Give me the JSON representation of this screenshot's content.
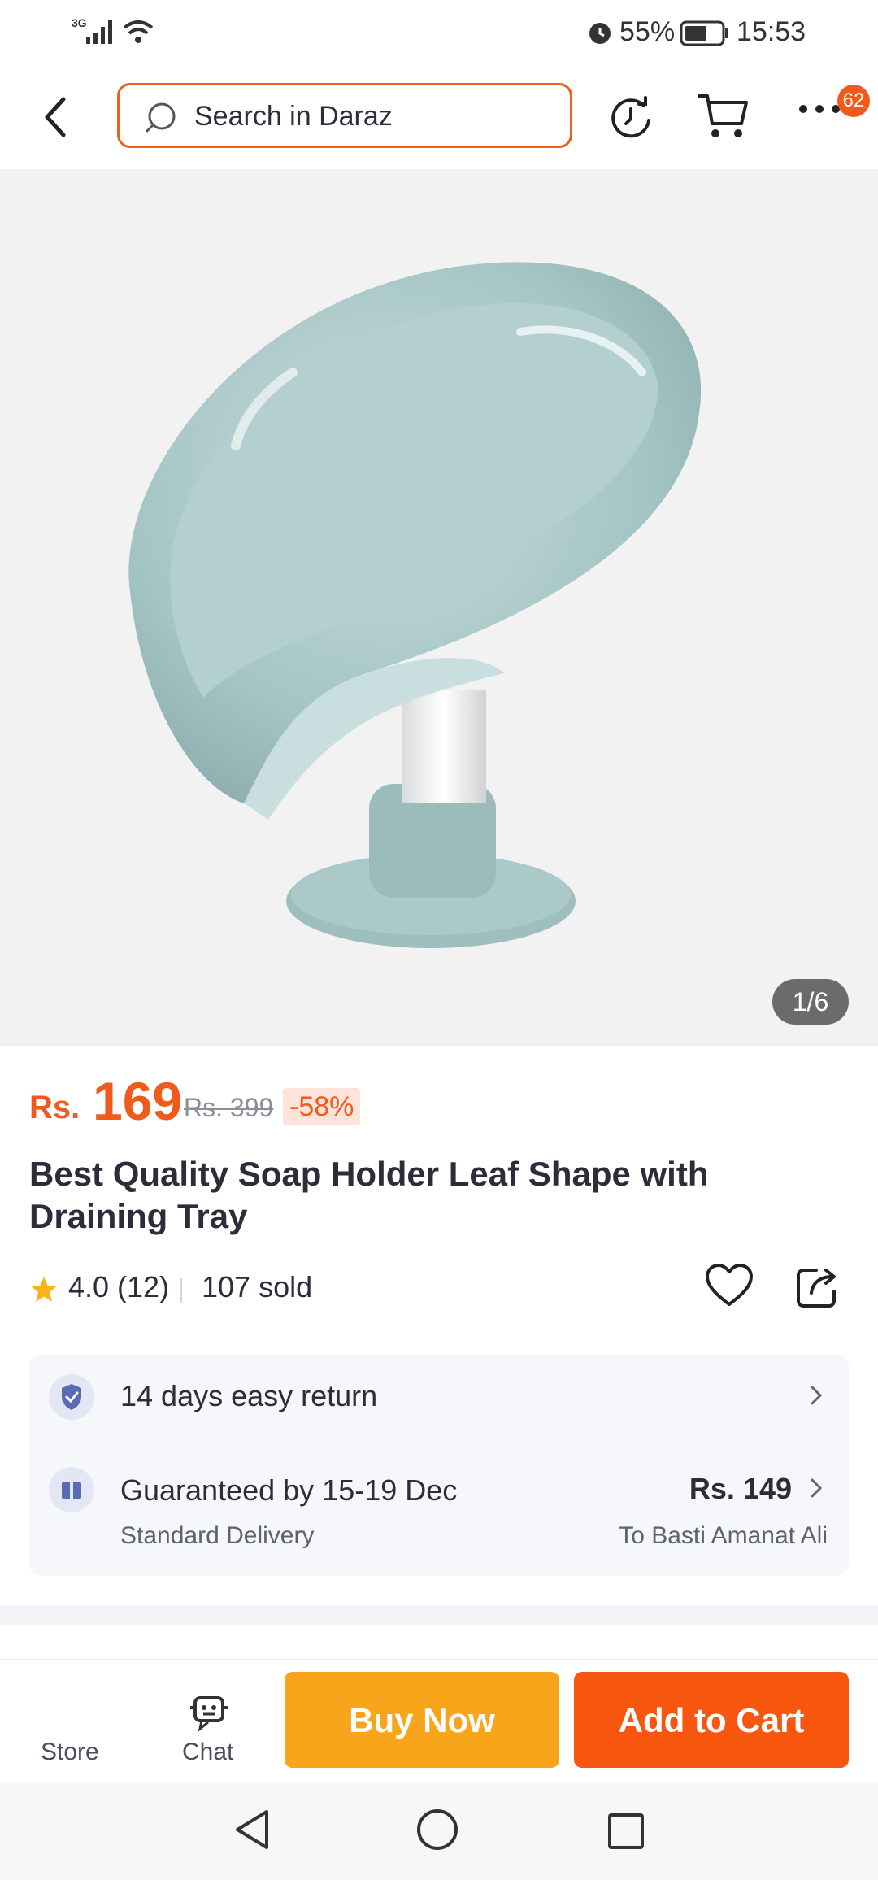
{
  "status_bar": {
    "network": "3G",
    "battery_pct": "55%",
    "time": "15:53"
  },
  "header": {
    "search_placeholder": "Search in Daraz",
    "notification_count": "62"
  },
  "gallery": {
    "image_counter": "1/6"
  },
  "product": {
    "currency": "Rs.",
    "price": "169",
    "original_price": "Rs. 399",
    "discount": "-58%",
    "title": "Best Quality Soap Holder Leaf Shape with Draining Tray",
    "rating": "4.0 (12)",
    "sold": "107 sold"
  },
  "services": {
    "return_policy": "14 days easy return",
    "delivery_guarantee": "Guaranteed by 15-19 Dec",
    "delivery_type": "Standard Delivery",
    "delivery_fee": "Rs. 149",
    "delivery_location": "To Basti Amanat Ali"
  },
  "action_bar": {
    "store_label": "Store",
    "chat_label": "Chat",
    "buy_now_label": "Buy Now",
    "add_to_cart_label": "Add to Cart"
  },
  "colors": {
    "brand_orange": "#f05a1a",
    "buy_now": "#f9a51c",
    "add_to_cart": "#f6560d",
    "product_color": "#a9c7c7"
  }
}
